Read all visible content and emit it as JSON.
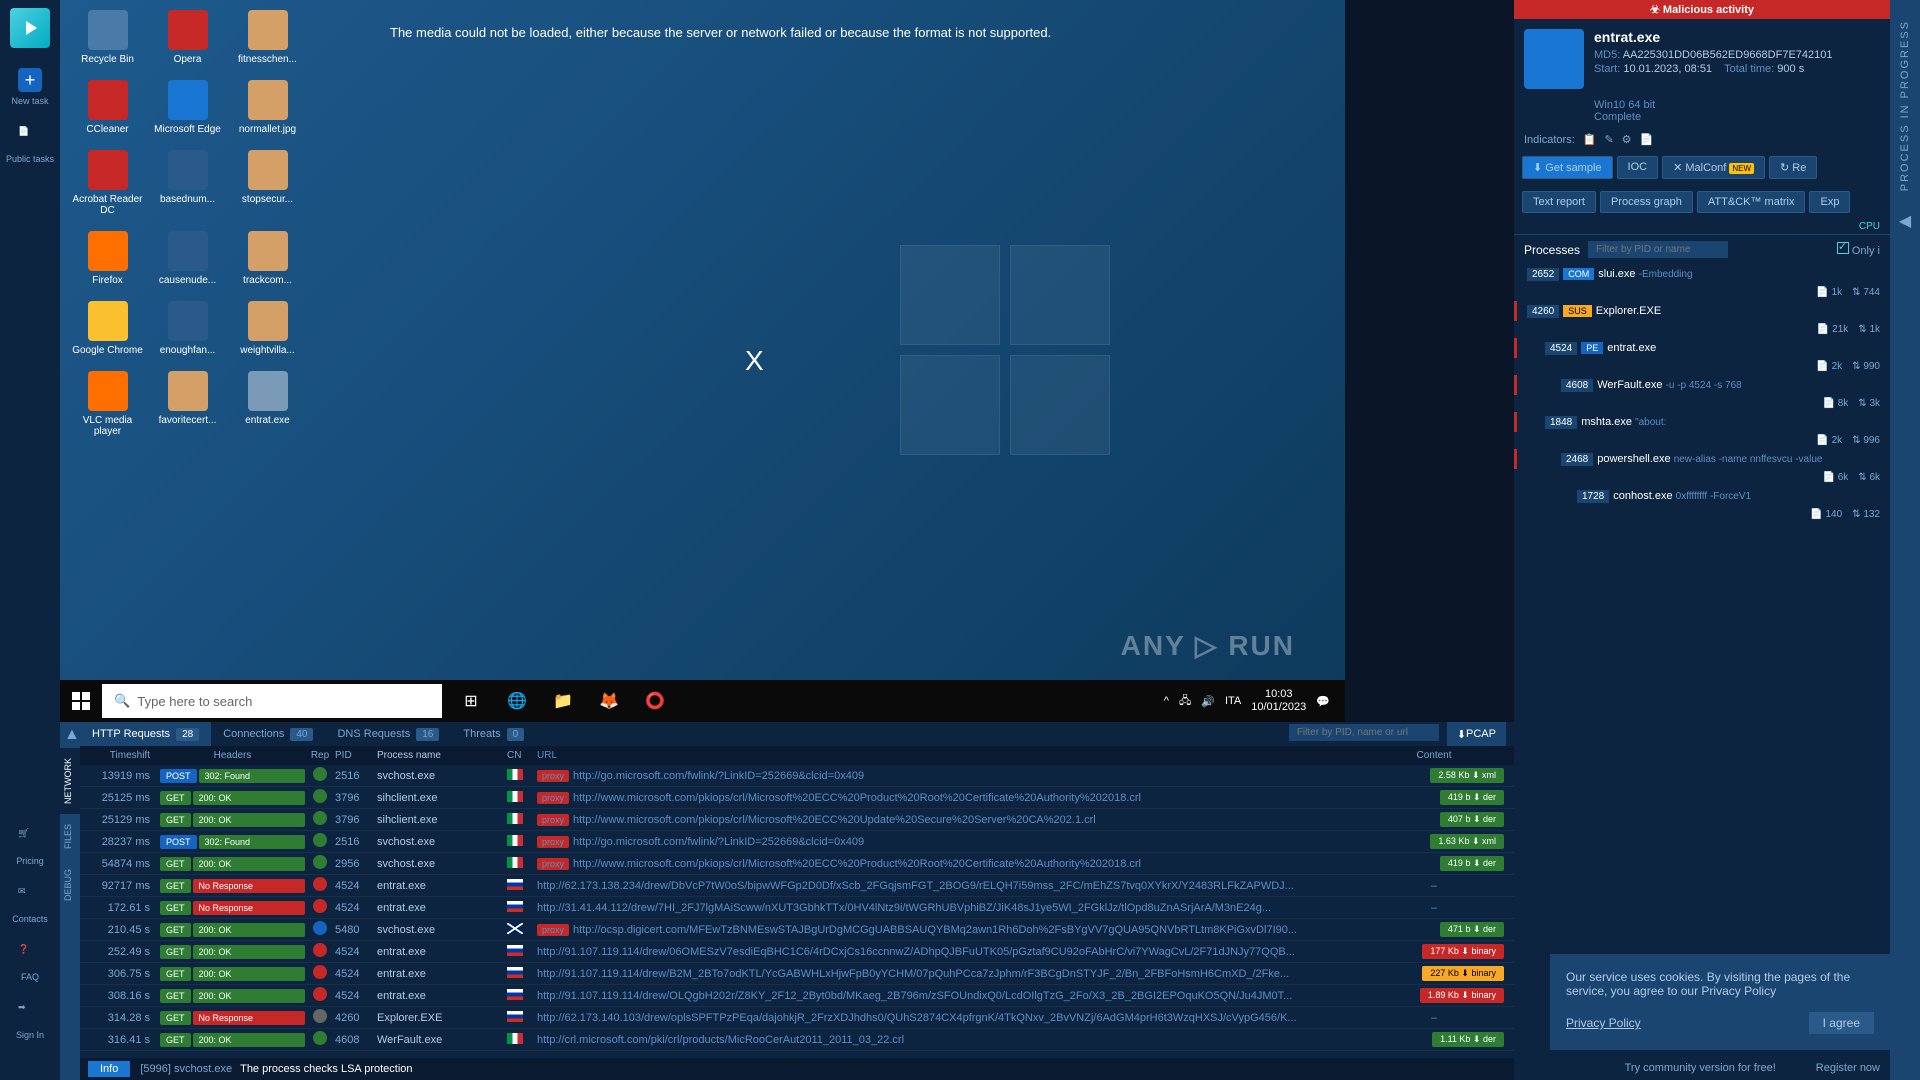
{
  "left_nav": {
    "new_task": "New task",
    "public_tasks": "Public tasks",
    "pricing": "Pricing",
    "contacts": "Contacts",
    "faq": "FAQ",
    "sign_in": "Sign In"
  },
  "desktop": {
    "error": "The media could not be loaded, either because the server or network failed or because the format is not supported.",
    "close": "X",
    "watermark": "ANY ▷ RUN",
    "icons": [
      {
        "label": "Recycle Bin",
        "color": "#4a7aa8"
      },
      {
        "label": "Opera",
        "color": "#c62828"
      },
      {
        "label": "fitnesschen...",
        "color": "#d4a068"
      },
      {
        "label": "CCleaner",
        "color": "#c62828"
      },
      {
        "label": "Microsoft Edge",
        "color": "#1976d2"
      },
      {
        "label": "normallet.jpg",
        "color": "#d4a068"
      },
      {
        "label": "Acrobat Reader DC",
        "color": "#c62828"
      },
      {
        "label": "basednum...",
        "color": "#2a5a8a"
      },
      {
        "label": "stopsecur...",
        "color": "#d4a068"
      },
      {
        "label": "Firefox",
        "color": "#ff6f00"
      },
      {
        "label": "causenude...",
        "color": "#2a5a8a"
      },
      {
        "label": "trackcom...",
        "color": "#d4a068"
      },
      {
        "label": "Google Chrome",
        "color": "#fbc02d"
      },
      {
        "label": "enoughfan...",
        "color": "#2a5a8a"
      },
      {
        "label": "weightvilla...",
        "color": "#d4a068"
      },
      {
        "label": "VLC media player",
        "color": "#ff6f00"
      },
      {
        "label": "favoritecert...",
        "color": "#d4a068"
      },
      {
        "label": "entrat.exe",
        "color": "#7a9ab8"
      }
    ],
    "taskbar": {
      "search_placeholder": "Type here to search",
      "lang": "ITA",
      "time": "10:03",
      "date": "10/01/2023"
    }
  },
  "analysis": {
    "banner": "☣ Malicious activity",
    "sample_name": "entrat.exe",
    "md5_label": "MD5:",
    "md5": "AA225301DD06B562ED9668DF7E742101",
    "start_label": "Start:",
    "start": "10.01.2023, 08:51",
    "total_label": "Total time:",
    "total": "900 s",
    "os": "Win10 64 bit",
    "status": "Complete",
    "indicators_label": "Indicators:",
    "buttons": {
      "get_sample": "Get sample",
      "ioc": "IOC",
      "malconf": "MalConf",
      "new_badge": "NEW",
      "restart": "Re",
      "text_report": "Text report",
      "process_graph": "Process graph",
      "attack": "ATT&CK™ matrix",
      "export": "Exp"
    },
    "cpu": "CPU",
    "processes_label": "Processes",
    "filter_placeholder": "Filter by PID or name",
    "only_label": "Only i",
    "tree": [
      {
        "lvl": 0,
        "pid": "2652",
        "tag": "COM",
        "tagClass": "com",
        "name": "slui.exe",
        "args": "-Embedding",
        "danger": false,
        "stats": {
          "a": "1k",
          "b": "744"
        }
      },
      {
        "lvl": 0,
        "pid": "4260",
        "tag": "SUS",
        "tagClass": "sus",
        "name": "Explorer.EXE",
        "args": "",
        "danger": true,
        "stats": {
          "a": "21k",
          "b": "1k"
        }
      },
      {
        "lvl": 1,
        "pid": "4524",
        "tag": "PE",
        "tagClass": "pe",
        "name": "entrat.exe",
        "args": "",
        "danger": true,
        "stats": {
          "a": "2k",
          "b": "990"
        }
      },
      {
        "lvl": 2,
        "pid": "4608",
        "tag": "",
        "tagClass": "",
        "name": "WerFault.exe",
        "args": "-u -p 4524 -s 768",
        "danger": true,
        "stats": {
          "a": "8k",
          "b": "3k"
        }
      },
      {
        "lvl": 1,
        "pid": "1848",
        "tag": "",
        "tagClass": "",
        "name": "mshta.exe",
        "args": "\"about:<hta:application><script>Wjcj='ws",
        "danger": true,
        "stats": {
          "a": "2k",
          "b": "996"
        }
      },
      {
        "lvl": 2,
        "pid": "2468",
        "tag": "",
        "tagClass": "",
        "name": "powershell.exe",
        "args": "new-alias -name nnffesvcu -value",
        "danger": true,
        "stats": {
          "a": "6k",
          "b": "6k"
        }
      },
      {
        "lvl": 3,
        "pid": "1728",
        "tag": "",
        "tagClass": "",
        "name": "conhost.exe",
        "args": "0xffffffff -ForceV1",
        "danger": false,
        "stats": {
          "a": "140",
          "b": "132"
        }
      }
    ]
  },
  "network": {
    "tabs": {
      "http": "HTTP Requests",
      "http_count": "28",
      "conn": "Connections",
      "conn_count": "40",
      "dns": "DNS Requests",
      "dns_count": "16",
      "threats": "Threats",
      "threats_count": "0"
    },
    "side_tabs": {
      "network": "NETWORK",
      "files": "FILES",
      "debug": "DEBUG"
    },
    "filter_placeholder": "Filter by PID, name or url",
    "pcap": "PCAP",
    "headers": {
      "ts": "Timeshift",
      "hdr": "Headers",
      "rep": "Rep",
      "pid": "PID",
      "proc": "Process name",
      "cn": "CN",
      "url": "URL",
      "content": "Content"
    },
    "rows": [
      {
        "ts": "13919 ms",
        "method": "POST",
        "status": "302: Found",
        "statusClass": "found",
        "rep": "safe",
        "pid": "2516",
        "proc": "svchost.exe",
        "flag": "it",
        "proxy": true,
        "url": "http://go.microsoft.com/fwlink/?LinkID=252669&clcid=0x409",
        "size": "2.58 Kb",
        "ctype": "xml",
        "ctypeClass": "xml"
      },
      {
        "ts": "25125 ms",
        "method": "GET",
        "status": "200: OK",
        "statusClass": "ok",
        "rep": "safe",
        "pid": "3796",
        "proc": "sihclient.exe",
        "flag": "it",
        "proxy": true,
        "url": "http://www.microsoft.com/pkiops/crl/Microsoft%20ECC%20Product%20Root%20Certificate%20Authority%202018.crl",
        "size": "419 b",
        "ctype": "der",
        "ctypeClass": "der"
      },
      {
        "ts": "25129 ms",
        "method": "GET",
        "status": "200: OK",
        "statusClass": "ok",
        "rep": "safe",
        "pid": "3796",
        "proc": "sihclient.exe",
        "flag": "it",
        "proxy": true,
        "url": "http://www.microsoft.com/pkiops/crl/Microsoft%20ECC%20Update%20Secure%20Server%20CA%202.1.crl",
        "size": "407 b",
        "ctype": "der",
        "ctypeClass": "der"
      },
      {
        "ts": "28237 ms",
        "method": "POST",
        "status": "302: Found",
        "statusClass": "found",
        "rep": "safe",
        "pid": "2516",
        "proc": "svchost.exe",
        "flag": "it",
        "proxy": true,
        "url": "http://go.microsoft.com/fwlink/?LinkID=252669&clcid=0x409",
        "size": "1.63 Kb",
        "ctype": "xml",
        "ctypeClass": "xml"
      },
      {
        "ts": "54874 ms",
        "method": "GET",
        "status": "200: OK",
        "statusClass": "ok",
        "rep": "safe",
        "pid": "2956",
        "proc": "svchost.exe",
        "flag": "it",
        "proxy": true,
        "url": "http://www.microsoft.com/pkiops/crl/Microsoft%20ECC%20Product%20Root%20Certificate%20Authority%202018.crl",
        "size": "419 b",
        "ctype": "der",
        "ctypeClass": "der"
      },
      {
        "ts": "92717 ms",
        "method": "GET",
        "status": "No Response",
        "statusClass": "noresp",
        "rep": "fire",
        "pid": "4524",
        "proc": "entrat.exe",
        "flag": "ru",
        "proxy": false,
        "url": "http://62.173.138.234/drew/DbVcP7tW0oS/bipwWFGp2D0Df/xScb_2FGqjsmFGT_2BOG9/rELQH7i59mss_2FC/mEhZS7tvq0XYkrX/Y2483RLFkZAPWDJ...",
        "size": "",
        "ctype": "",
        "ctypeClass": ""
      },
      {
        "ts": "172.61 s",
        "method": "GET",
        "status": "No Response",
        "statusClass": "noresp",
        "rep": "fire",
        "pid": "4524",
        "proc": "entrat.exe",
        "flag": "ru",
        "proxy": false,
        "url": "http://31.41.44.112/drew/7HI_2FJ7lgMAiScww/nXUT3GbhkTTx/0HV4lNtz9i/tWGRhUBVphiBZ/JiK48sJ1ye5WI_2FGklJz/tlOpd8uZnASrjArA/M3nE24g...",
        "size": "",
        "ctype": "",
        "ctypeClass": ""
      },
      {
        "ts": "210.45 s",
        "method": "GET",
        "status": "200: OK",
        "statusClass": "ok",
        "rep": "shield",
        "pid": "5480",
        "proc": "svchost.exe",
        "flag": "gb",
        "proxy": true,
        "url": "http://ocsp.digicert.com/MFEwTzBNMEswSTAJBgUrDgMCGgUABBSAUQYBMq2awn1Rh6Doh%2FsBYgVV7gQUA95QNVbRTLtm8KPiGxvDl7I90...",
        "size": "471 b",
        "ctype": "der",
        "ctypeClass": "der"
      },
      {
        "ts": "252.49 s",
        "method": "GET",
        "status": "200: OK",
        "statusClass": "ok",
        "rep": "fire",
        "pid": "4524",
        "proc": "entrat.exe",
        "flag": "ru",
        "proxy": false,
        "url": "http://91.107.119.114/drew/06OMESzV7esdiEqBHC1C6/4rDCxjCs16ccnnwZ/ADhpQJBFuUTK05/pGztaf9CU92oFAbHrC/vi7YWagCvL/2F71dJNJy77QQB...",
        "size": "177 Kb",
        "ctype": "binary",
        "ctypeClass": "binary danger"
      },
      {
        "ts": "306.75 s",
        "method": "GET",
        "status": "200: OK",
        "statusClass": "ok",
        "rep": "fire",
        "pid": "4524",
        "proc": "entrat.exe",
        "flag": "ru",
        "proxy": false,
        "url": "http://91.107.119.114/drew/B2M_2BTo7odKTL/YcGABWHLxHjwFpB0yYCHM/07pQuhPCca7zJphm/rF3BCgDnSTYJF_2/Bn_2FBFoHsmH6CmXD_/2Fke...",
        "size": "227 Kb",
        "ctype": "binary",
        "ctypeClass": "binary"
      },
      {
        "ts": "308.16 s",
        "method": "GET",
        "status": "200: OK",
        "statusClass": "ok",
        "rep": "fire",
        "pid": "4524",
        "proc": "entrat.exe",
        "flag": "ru",
        "proxy": false,
        "url": "http://91.107.119.114/drew/OLQgbH202r/Z8KY_2F12_2Byt0bd/MKaeg_2B796m/zSFOUndixQ0/LcdOIlgTzG_2Fo/X3_2B_2BGI2EPOquKO5QN/Ju4JM0T...",
        "size": "1.89 Kb",
        "ctype": "binary",
        "ctypeClass": "binary danger"
      },
      {
        "ts": "314.28 s",
        "method": "GET",
        "status": "No Response",
        "statusClass": "noresp",
        "rep": "unknown",
        "pid": "4260",
        "proc": "Explorer.EXE",
        "flag": "ru",
        "proxy": false,
        "url": "http://62.173.140.103/drew/oplsSPFTPzPEqa/dajohkjR_2FrzXDJhdhs0/QUhS2874CX4pfrgnK/4TkQNxv_2BvVNZj/6AdGM4prH6t3WzqHXSJ/cVypG456/K...",
        "size": "",
        "ctype": "",
        "ctypeClass": ""
      },
      {
        "ts": "316.41 s",
        "method": "GET",
        "status": "200: OK",
        "statusClass": "ok",
        "rep": "safe",
        "pid": "4608",
        "proc": "WerFault.exe",
        "flag": "it",
        "proxy": false,
        "url": "http://crl.microsoft.com/pki/crl/products/MicRooCerAut2011_2011_03_22.crl",
        "size": "1.11 Kb",
        "ctype": "der",
        "ctypeClass": "der"
      }
    ]
  },
  "status_bar": {
    "info": "Info",
    "proc_ref": "[5996] svchost.exe",
    "msg": "The process checks LSA protection"
  },
  "cookie": {
    "text": "Our service uses cookies. By visiting the pages of the service, you agree to our Privacy Policy",
    "link": "Privacy Policy",
    "agree": "I agree"
  },
  "br": {
    "try": "Try community version for free!",
    "register": "Register now"
  },
  "vertical": {
    "label": "PROCESS IN PROGRESS"
  }
}
